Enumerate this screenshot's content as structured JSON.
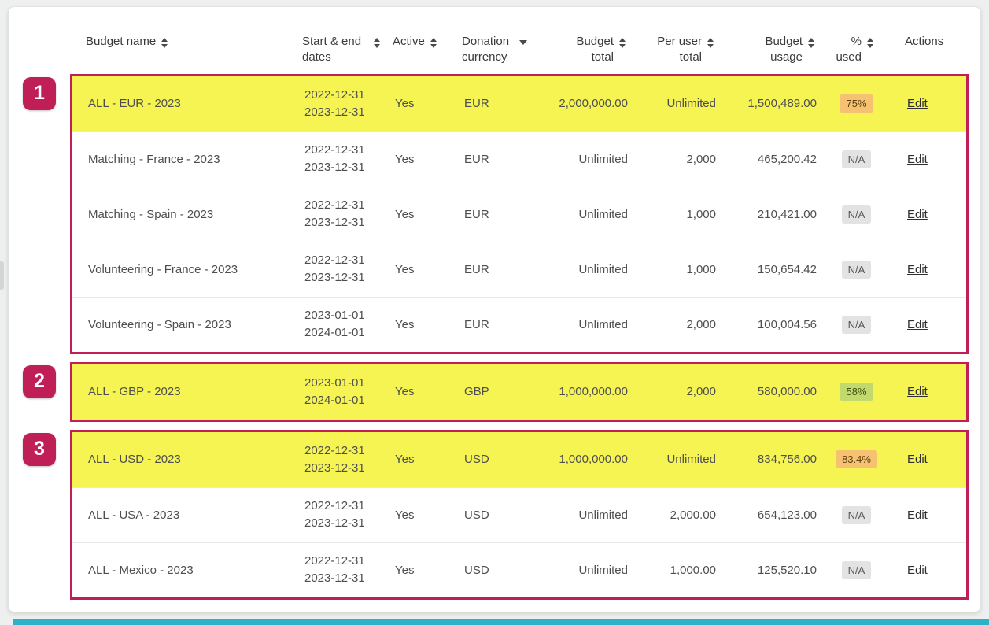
{
  "labels": {
    "edit": "Edit"
  },
  "annotations": {
    "badges": [
      "1",
      "2",
      "3"
    ]
  },
  "table": {
    "columns": [
      {
        "label": "Budget name",
        "sort": "both"
      },
      {
        "label": "Start & end dates",
        "sort": "both"
      },
      {
        "label": "Active",
        "sort": "both"
      },
      {
        "label": "Donation currency",
        "sort": "down"
      },
      {
        "label": "Budget total",
        "sort": "both"
      },
      {
        "label": "Per user total",
        "sort": "both"
      },
      {
        "label": "Budget usage",
        "sort": "both"
      },
      {
        "label": "% used",
        "sort": "both"
      },
      {
        "label": "Actions",
        "sort": "none"
      }
    ],
    "groups": [
      {
        "rows": [
          {
            "name": "ALL - EUR - 2023",
            "start": "2022-12-31",
            "end": "2023-12-31",
            "active": "Yes",
            "currency": "EUR",
            "total": "2,000,000.00",
            "per_user": "Unlimited",
            "usage": "1,500,489.00",
            "pct": "75%",
            "highlighted": true
          },
          {
            "name": "Matching - France - 2023",
            "start": "2022-12-31",
            "end": "2023-12-31",
            "active": "Yes",
            "currency": "EUR",
            "total": "Unlimited",
            "per_user": "2,000",
            "usage": "465,200.42",
            "pct": "N/A",
            "highlighted": false
          },
          {
            "name": "Matching - Spain - 2023",
            "start": "2022-12-31",
            "end": "2023-12-31",
            "active": "Yes",
            "currency": "EUR",
            "total": "Unlimited",
            "per_user": "1,000",
            "usage": "210,421.00",
            "pct": "N/A",
            "highlighted": false
          },
          {
            "name": "Volunteering - France - 2023",
            "start": "2022-12-31",
            "end": "2023-12-31",
            "active": "Yes",
            "currency": "EUR",
            "total": "Unlimited",
            "per_user": "1,000",
            "usage": "150,654.42",
            "pct": "N/A",
            "highlighted": false
          },
          {
            "name": "Volunteering - Spain - 2023",
            "start": "2023-01-01",
            "end": "2024-01-01",
            "active": "Yes",
            "currency": "EUR",
            "total": "Unlimited",
            "per_user": "2,000",
            "usage": "100,004.56",
            "pct": "N/A",
            "highlighted": false
          }
        ]
      },
      {
        "rows": [
          {
            "name": "ALL - GBP - 2023",
            "start": "2023-01-01",
            "end": "2024-01-01",
            "active": "Yes",
            "currency": "GBP",
            "total": "1,000,000.00",
            "per_user": "2,000",
            "usage": "580,000.00",
            "pct": "58%",
            "highlighted": true
          }
        ]
      },
      {
        "rows": [
          {
            "name": "ALL - USD - 2023",
            "start": "2022-12-31",
            "end": "2023-12-31",
            "active": "Yes",
            "currency": "USD",
            "total": "1,000,000.00",
            "per_user": "Unlimited",
            "usage": "834,756.00",
            "pct": "83.4%",
            "highlighted": true
          },
          {
            "name": "ALL - USA - 2023",
            "start": "2022-12-31",
            "end": "2023-12-31",
            "active": "Yes",
            "currency": "USD",
            "total": "Unlimited",
            "per_user": "2,000.00",
            "usage": "654,123.00",
            "pct": "N/A",
            "highlighted": false
          },
          {
            "name": "ALL - Mexico - 2023",
            "start": "2022-12-31",
            "end": "2023-12-31",
            "active": "Yes",
            "currency": "USD",
            "total": "Unlimited",
            "per_user": "1,000.00",
            "usage": "125,520.10",
            "pct": "N/A",
            "highlighted": false
          }
        ]
      }
    ]
  },
  "colors": {
    "annotation_crimson": "#c01e56",
    "row_highlight_yellow": "#f6f452",
    "badge_orange": "#f6c272",
    "badge_green": "#c1da6b",
    "badge_gray": "#e3e3e3",
    "bottom_bar_teal": "#2cb2c7"
  }
}
